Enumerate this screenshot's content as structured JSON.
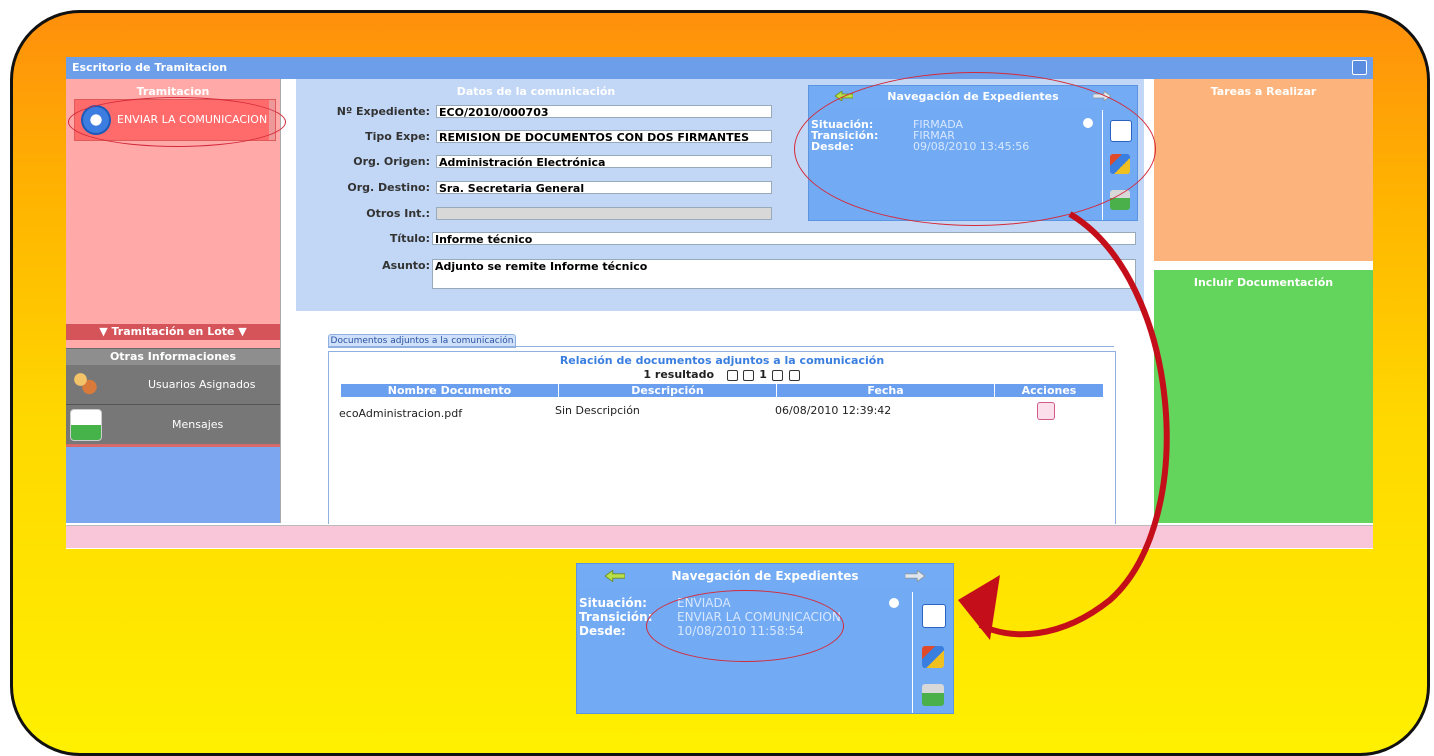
{
  "window": {
    "title": "Escritorio de Tramitacion"
  },
  "left": {
    "tramitacion_title": "Tramitacion",
    "enviar_label": "ENVIAR LA COMUNICACION",
    "lote_label": "▼ Tramitación en Lote ▼",
    "otras_title": "Otras Informaciones",
    "usuarios_label": "Usuarios Asignados",
    "mensajes_label": "Mensajes"
  },
  "form": {
    "section_title": "Datos de la comunicación",
    "expediente_label": "Nº Expediente:",
    "expediente_value": "ECO/2010/000703",
    "tipo_label": "Tipo Expe:",
    "tipo_value": "REMISION DE DOCUMENTOS CON DOS FIRMANTES",
    "origen_label": "Org. Origen:",
    "origen_value": "Administración Electrónica",
    "destino_label": "Org. Destino:",
    "destino_value": "Sra. Secretaria General",
    "otros_label": "Otros Int.:",
    "otros_value": "",
    "titulo_label": "Título:",
    "titulo_value": "Informe técnico",
    "asunto_label": "Asunto:",
    "asunto_value": "Adjunto se remite Informe técnico"
  },
  "nav_top": {
    "title": "Navegación de Expedientes",
    "situacion_label": "Situación:",
    "situacion_value": "FIRMADA",
    "transicion_label": "Transición:",
    "transicion_value": "FIRMAR",
    "desde_label": "Desde:",
    "desde_value": "09/08/2010 13:45:56"
  },
  "nav_bottom": {
    "title": "Navegación de Expedientes",
    "situacion_label": "Situación:",
    "situacion_value": "ENVIADA",
    "transicion_label": "Transición:",
    "transicion_value": "ENVIAR LA COMUNICACION",
    "desde_label": "Desde:",
    "desde_value": "10/08/2010 11:58:54"
  },
  "right": {
    "tareas_title": "Tareas a Realizar",
    "incluir_title": "Incluir Documentación"
  },
  "docs": {
    "tab_label": "Documentos adjuntos a la comunicación",
    "title": "Relación de documentos adjuntos a la comunicación",
    "result_count": "1 resultado",
    "current_page": "1",
    "columns": [
      "Nombre Documento",
      "Descripción",
      "Fecha",
      "Acciones"
    ],
    "rows": [
      {
        "nombre": "ecoAdministracion.pdf",
        "descripcion": "Sin Descripción",
        "fecha": "06/08/2010 12:39:42"
      }
    ]
  },
  "colors": {
    "titlebar": "#6d9eea",
    "left_panel": "#ffa9a9",
    "nav_panel": "#72aaf3",
    "tareas": "#fdb47c",
    "incluir": "#63d45c",
    "annotation": "#c40f1a"
  }
}
